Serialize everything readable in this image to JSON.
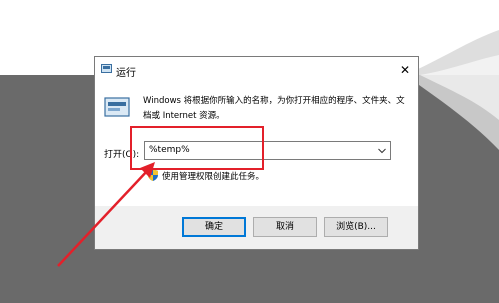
{
  "dialog": {
    "title": "运行",
    "description": "Windows 将根据你所输入的名称，为你打开相应的程序、文件夹、文档或 Internet 资源。",
    "open_label": "打开(O):",
    "command_value": "%temp%",
    "admin_note": "使用管理权限创建此任务。",
    "buttons": {
      "ok": "确定",
      "cancel": "取消",
      "browse": "浏览(B)..."
    }
  },
  "colors": {
    "highlight": "#e3202a",
    "accent": "#0078d7",
    "background_dark": "#6a6a6a"
  },
  "icons": [
    "run-app-icon",
    "close-icon",
    "chevron-down-icon",
    "shield-icon"
  ]
}
